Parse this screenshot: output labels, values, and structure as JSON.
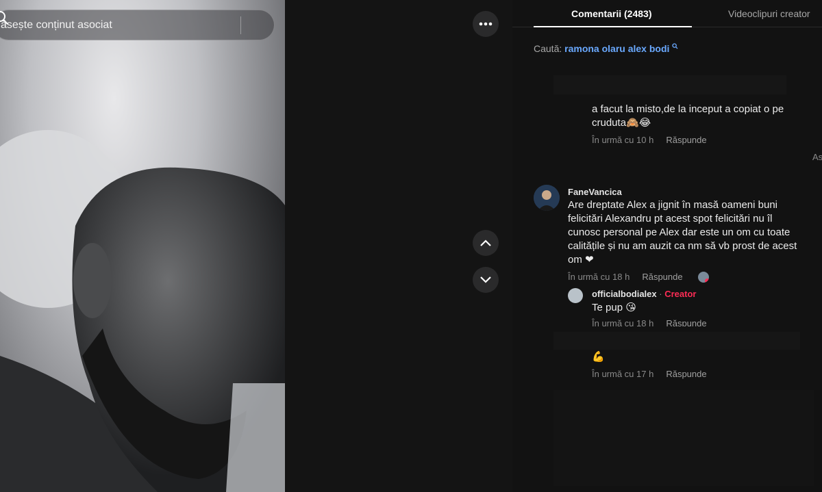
{
  "video": {
    "search_placeholder": "ăsește conținut asociat"
  },
  "panel": {
    "tabs": [
      {
        "label": "Comentarii (2483)"
      },
      {
        "label": "Videoclipuri creator"
      }
    ],
    "search": {
      "label": "Caută:",
      "query": "ramona olaru alex bodi"
    },
    "comments": [
      {
        "text_line1": "a facut la misto,de la inceput a copiat o pe",
        "text_line2": "cruduta🙈😂",
        "time": "În urmă cu 10 h",
        "reply_label": "Răspunde"
      },
      {
        "username": "FaneVancica",
        "lines": [
          "Are dreptate Alex a jignit în masă oameni buni",
          "felicitări Alexandru pt acest spot felicitări nu îl",
          "cunosc personal pe Alex dar este un om cu toate",
          "calitățile și nu am auzit ca nm să vb prost de acest",
          "om ❤"
        ],
        "time": "În urmă cu 18 h",
        "reply_label": "Răspunde"
      }
    ],
    "creator_reply": {
      "username": "officialbodialex",
      "separator": "·",
      "badge": "Creator",
      "text": "Te pup 😘",
      "time": "În urmă cu 18 h",
      "reply_label": "Răspunde"
    },
    "last_reply": {
      "text": "💪",
      "time": "În urmă cu 17 h",
      "reply_label": "Răspunde"
    },
    "edge_text": "As"
  },
  "colors": {
    "accent": "#fe2c55",
    "link": "#6aa9ff",
    "panel_bg": "#121212"
  }
}
